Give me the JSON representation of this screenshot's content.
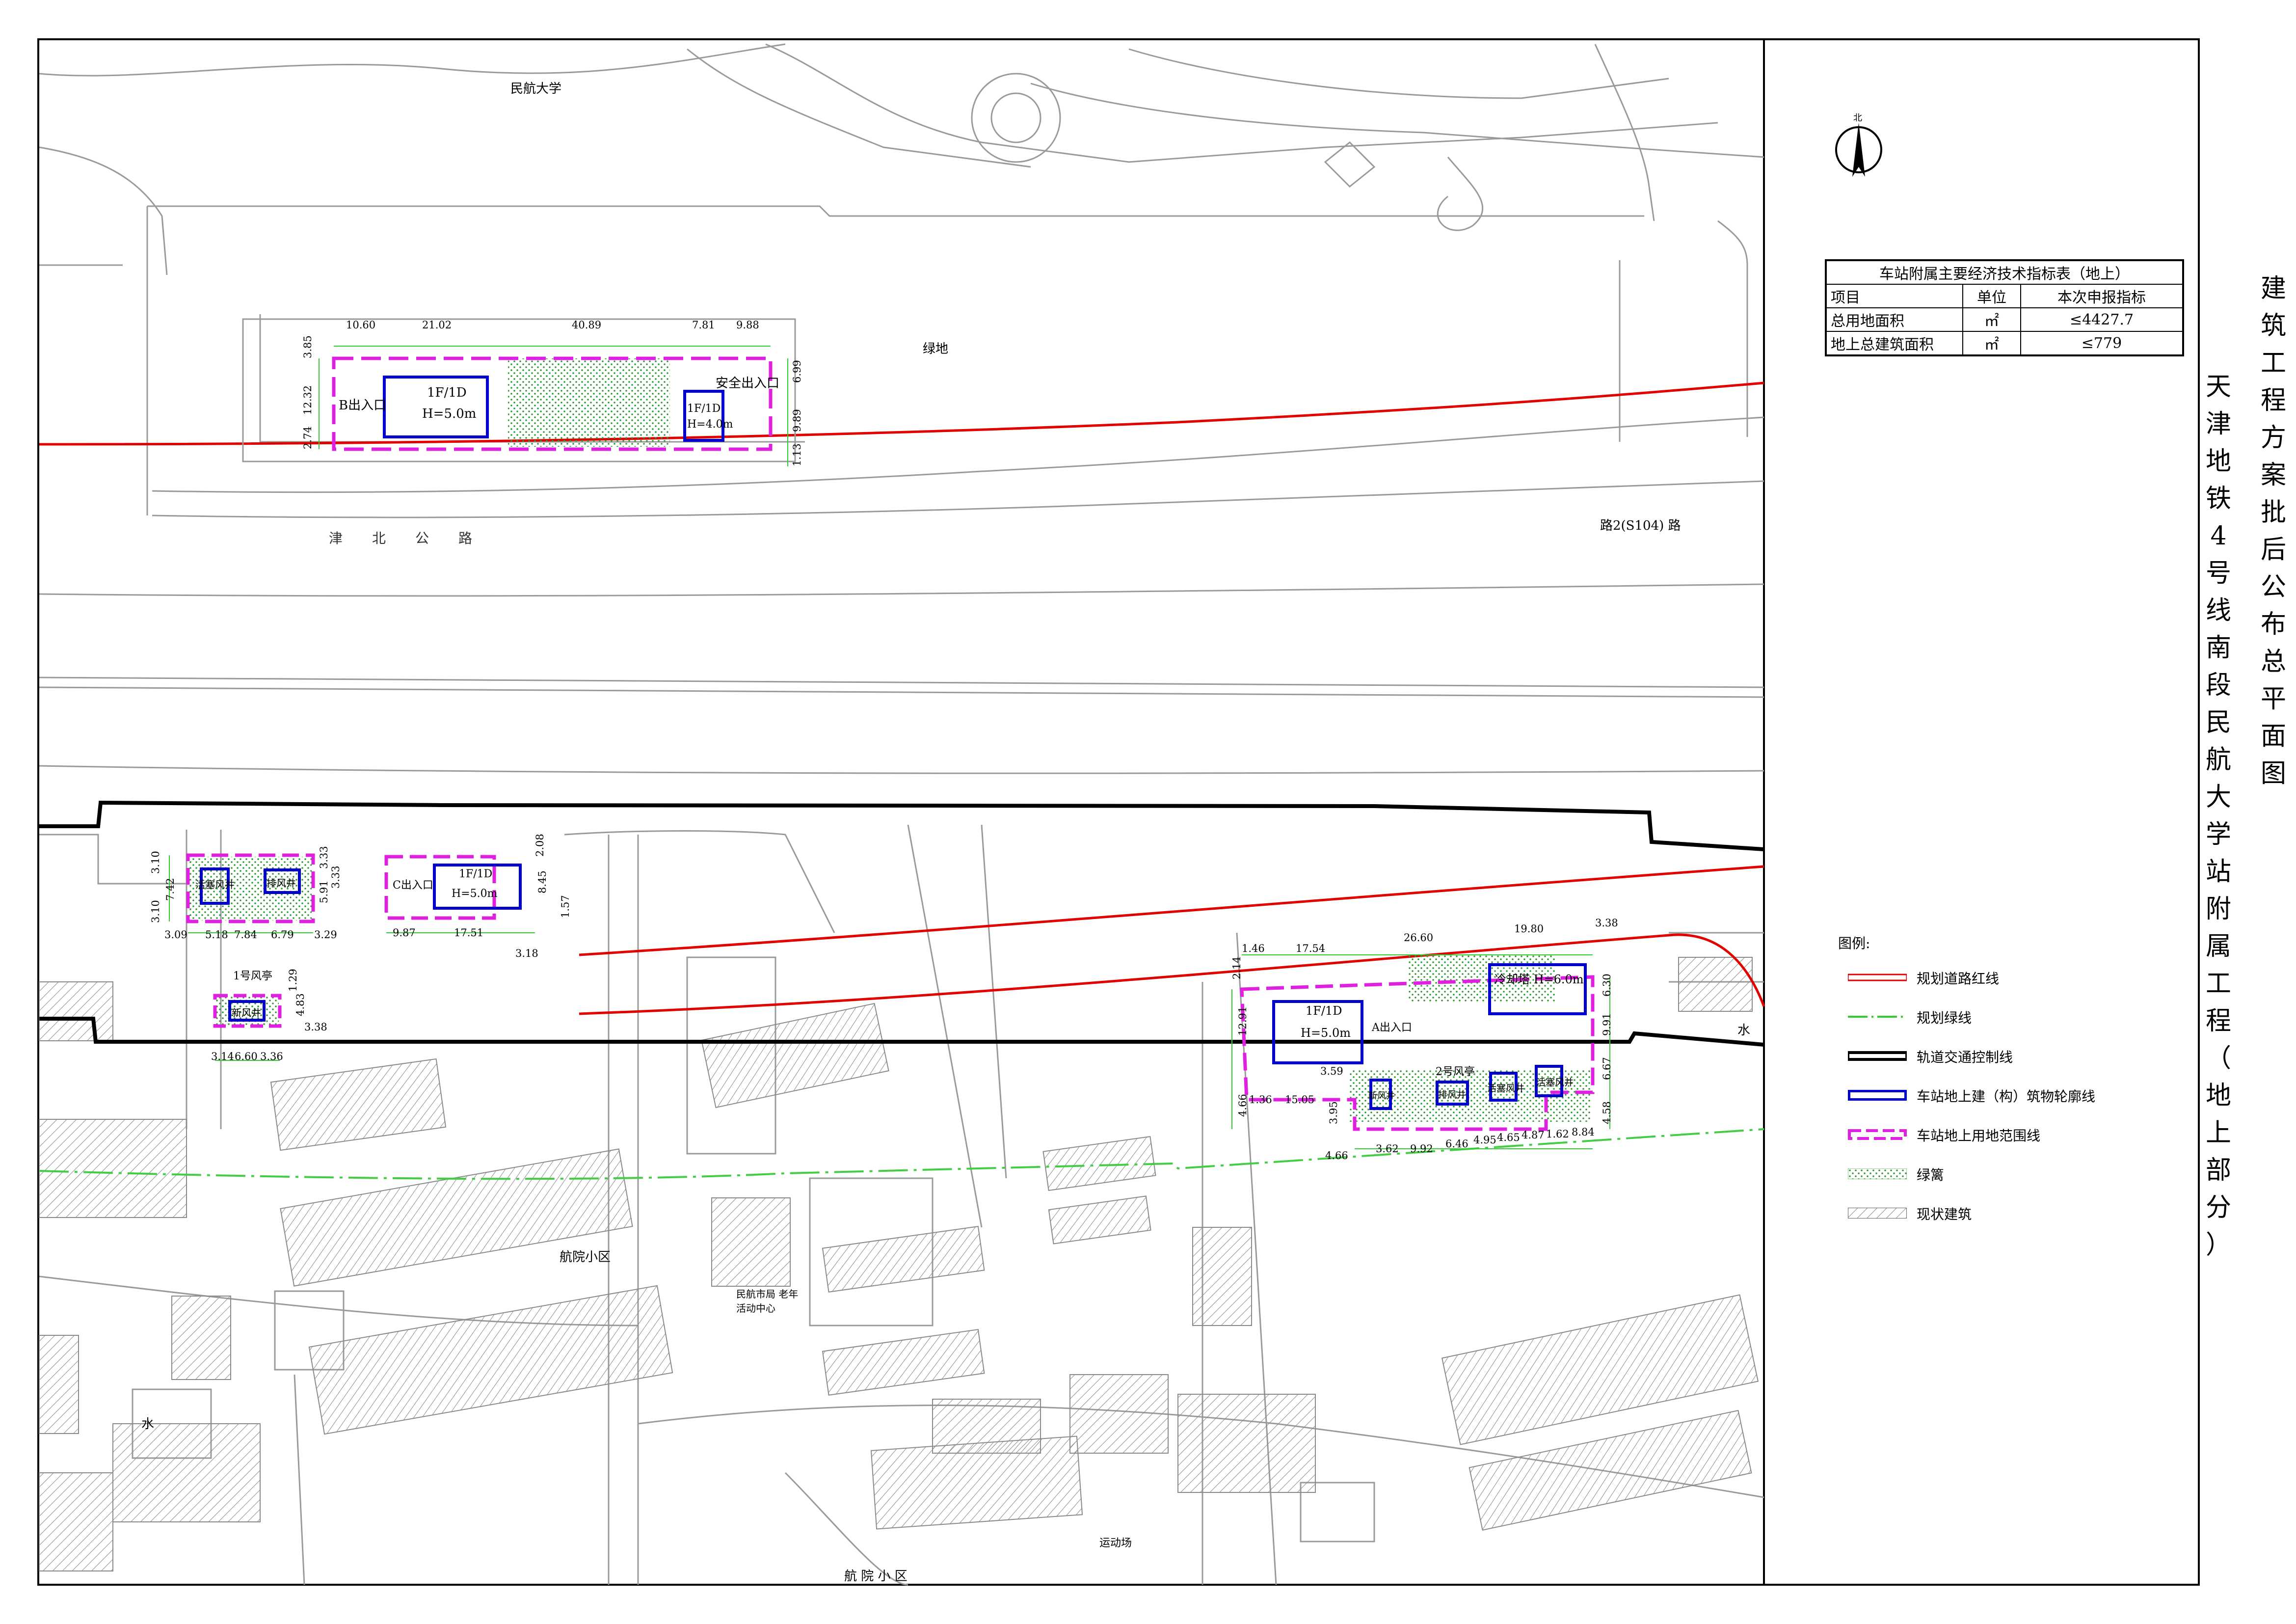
{
  "title": {
    "main": "建筑工程方案批后公布总平面图",
    "project": "天津地铁4号线南段民航大学站附属工程（地上部分）"
  },
  "index_table": {
    "caption": "车站附属主要经济技术指标表（地上）",
    "headers": [
      "项目",
      "单位",
      "本次申报指标"
    ],
    "rows": [
      [
        "总用地面积",
        "㎡",
        "≤4427.7"
      ],
      [
        "地上总建筑面积",
        "㎡",
        "≤779"
      ]
    ]
  },
  "legend": {
    "title": "图例:",
    "items": [
      {
        "label": "规划道路红线",
        "color": "#e00000",
        "style": "solid"
      },
      {
        "label": "规划绿线",
        "color": "#33cc33",
        "style": "dashdot"
      },
      {
        "label": "轨道交通控制线",
        "color": "#000000",
        "style": "solid-thick"
      },
      {
        "label": "车站地上建（构）筑物轮廓线",
        "color": "#0000cc",
        "style": "box"
      },
      {
        "label": "车站地上用地范围线",
        "color": "#e020e0",
        "style": "dashed"
      },
      {
        "label": "绿篱",
        "color": "#33aa33",
        "style": "dots"
      },
      {
        "label": "现状建筑",
        "color": "#666666",
        "style": "hatch"
      }
    ]
  },
  "colors": {
    "road_red_line": "#e00000",
    "green_line": "#33cc33",
    "rail_control_line": "#000000",
    "building_outline": "#0000cc",
    "land_boundary": "#e020e0",
    "hedge": "#33aa33",
    "existing_building": "#666666",
    "base_map": "#9a9a9a"
  },
  "north_arrow": {
    "label": "北",
    "icon": "north-arrow-icon"
  },
  "map_labels": {
    "campus": "民航大学",
    "green_area": "绿地",
    "road_name": "津北公路",
    "road_code": "路2(S104) 路",
    "community_1": "航院小区",
    "community_2": "航 院 小 区",
    "sports_field": "运动场",
    "water": "水",
    "activity_center": "民航市局 老年活动中心"
  },
  "site_north": {
    "entrance_b": "B出入口",
    "building_1": {
      "floors": "1F/1D",
      "height": "H=5.0m"
    },
    "building_2": {
      "floors": "1F/1D",
      "height": "H=4.0m"
    },
    "safety_exit": "安全出入口",
    "dims_top": [
      "10.60",
      "21.02",
      "40.89",
      "7.81",
      "9.88"
    ],
    "dims_left": [
      "3.85",
      "12.32",
      "2.74"
    ],
    "dims_right": [
      "6.99",
      "9.89",
      "1.13"
    ]
  },
  "site_west": {
    "exhaust_shaft": "活塞风井",
    "exhaust_shaft_2": "排风井",
    "pavilion": "1号风亭",
    "fresh_air_shaft": "新风井",
    "dims_left": [
      "3.10",
      "7.42",
      "3.10"
    ],
    "dims_bottom": [
      "3.09",
      "5.18",
      "7.84",
      "6.79",
      "3.29"
    ],
    "dims_right": [
      "3.33",
      "5.91",
      "3.33"
    ],
    "pavilion_dims_bottom": [
      "3.14",
      "6.60",
      "3.36"
    ],
    "pavilion_dims_right": [
      "1.29",
      "4.83",
      "3.38"
    ]
  },
  "site_c": {
    "entrance_c": "C出入口",
    "building": {
      "floors": "1F/1D",
      "height": "H=5.0m"
    },
    "dims_bottom": [
      "9.87",
      "17.51",
      "3.18"
    ],
    "dims_right": [
      "2.08",
      "8.45",
      "1.57"
    ]
  },
  "site_east": {
    "building": {
      "floors": "1F/1D",
      "height": "H=5.0m"
    },
    "entrance_a": "A出入口",
    "cooling_tower": "冷却塔 H=6.0m",
    "pavilion_2": "2号风亭",
    "fresh_air": "新风井",
    "exhaust": "排风井",
    "piston_1": "活塞风井",
    "piston_2": "活塞风井",
    "dims_top": [
      "1.46",
      "17.54",
      "26.60",
      "19.80",
      "3.38"
    ],
    "dims_left": [
      "2.14",
      "12.91",
      "4.66",
      "1.36"
    ],
    "dims_mid": [
      "15.05",
      "3.59",
      "3.95"
    ],
    "dims_bottom": [
      "4.66",
      "3.62",
      "9.92",
      "6.46",
      "4.95",
      "4.65",
      "4.87",
      "1.62",
      "8.84"
    ],
    "dims_right": [
      "6.30",
      "9.91",
      "6.67",
      "4.58"
    ]
  }
}
